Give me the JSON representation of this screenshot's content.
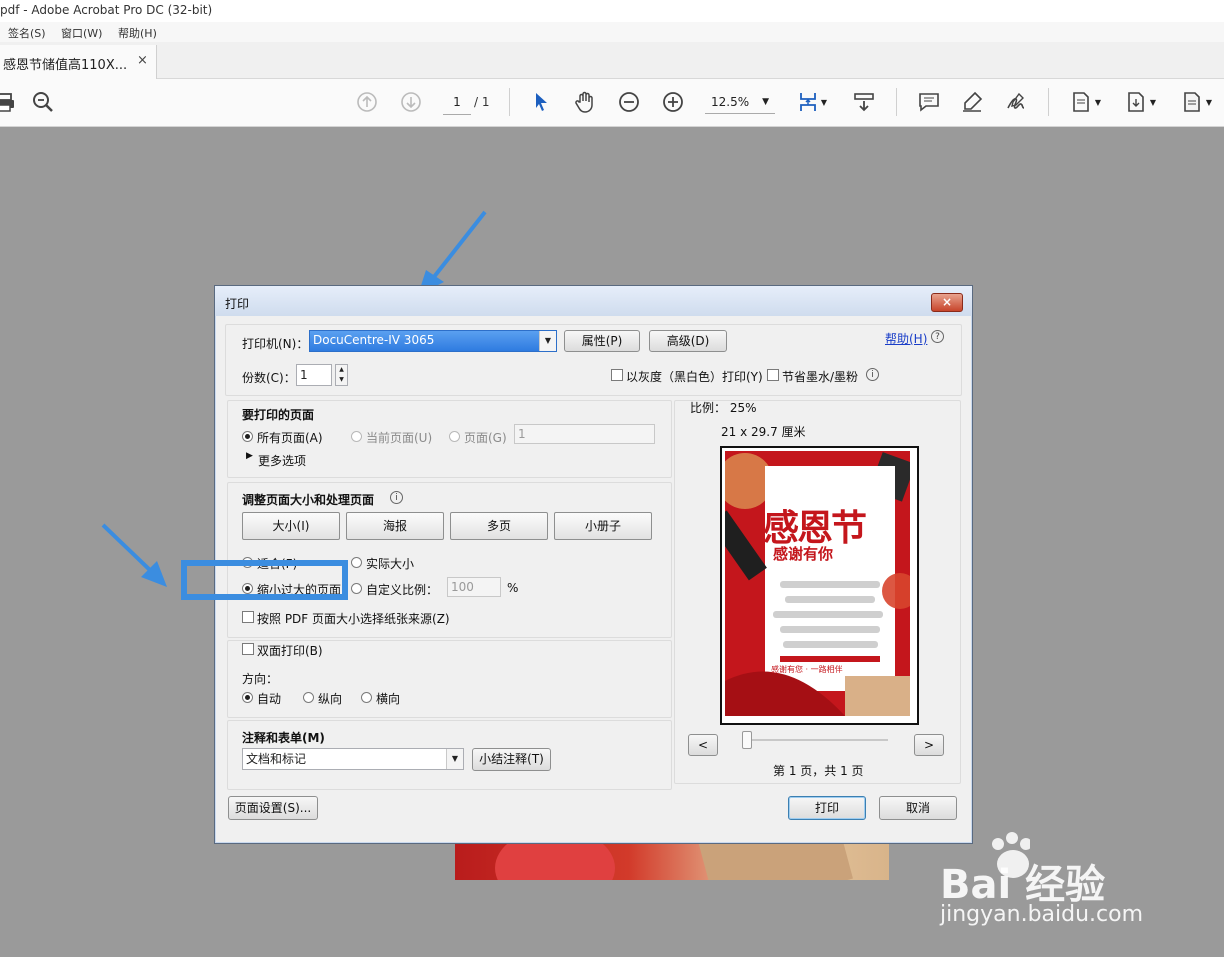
{
  "window": {
    "title": "pdf - Adobe Acrobat Pro DC (32-bit)"
  },
  "menu": [
    "签名(S)",
    "窗口(W)",
    "帮助(H)"
  ],
  "tab": {
    "label": "感恩节储值高110X...",
    "close": "×"
  },
  "toolbar": {
    "page_current": "1",
    "page_total": "/ 1",
    "zoom": "12.5%",
    "icons": [
      "print-icon",
      "search-zoom-icon",
      "page-up-icon",
      "page-down-icon",
      "select-arrow-icon",
      "hand-icon",
      "zoom-out-icon",
      "zoom-in-icon",
      "fit-page-icon",
      "scroll-mode-icon",
      "comment-icon",
      "highlight-icon",
      "sign-icon",
      "page-tool-icon",
      "export-icon",
      "file-icon"
    ]
  },
  "dialog": {
    "title": "打印",
    "close": "×",
    "printer_label": "打印机(N)：",
    "printer_value": "DocuCentre-IV 3065",
    "properties_btn": "属性(P)",
    "advanced_btn": "高级(D)",
    "help_link": "帮助(H)",
    "copies_label": "份数(C)：",
    "copies_value": "1",
    "grayscale_label": "以灰度（黑白色）打印(Y)",
    "save_ink_label": "节省墨水/墨粉",
    "pages_section": {
      "title": "要打印的页面",
      "all_pages": "所有页面(A)",
      "current_page": "当前页面(U)",
      "pages": "页面(G)",
      "pages_value": "1",
      "more_options": "更多选项"
    },
    "sizing_section": {
      "title": "调整页面大小和处理页面",
      "buttons": [
        "大小(I)",
        "海报",
        "多页",
        "小册子"
      ],
      "fit": "适合(F)",
      "actual_size": "实际大小",
      "shrink": "缩小过大的页面",
      "custom_scale": "自定义比例：",
      "custom_value": "100",
      "percent": "%",
      "paper_source": "按照 PDF 页面大小选择纸张来源(Z)"
    },
    "duplex_label": "双面打印(B)",
    "orientation": {
      "title": "方向：",
      "auto": "自动",
      "portrait": "纵向",
      "landscape": "横向"
    },
    "comments_section": {
      "title": "注释和表单(M)",
      "select_value": "文档和标记",
      "summarize_btn": "小结注释(T)"
    },
    "preview": {
      "scale": "比例：  25%",
      "size": "21 x 29.7 厘米",
      "page_info": "第 1 页，共 1 页",
      "prev": "<",
      "next": ">",
      "poster_title": "感恩节",
      "poster_subtitle": "感谢有你",
      "poster_footer": "感谢有您 · 一路相伴"
    },
    "page_setup_btn": "页面设置(S)...",
    "print_btn": "打印",
    "cancel_btn": "取消"
  },
  "watermark": {
    "brand": "Bai 经验",
    "url": "jingyan.baidu.com"
  },
  "colors": {
    "accent_blue": "#3b8de0",
    "poster_red": "#c4161c"
  }
}
